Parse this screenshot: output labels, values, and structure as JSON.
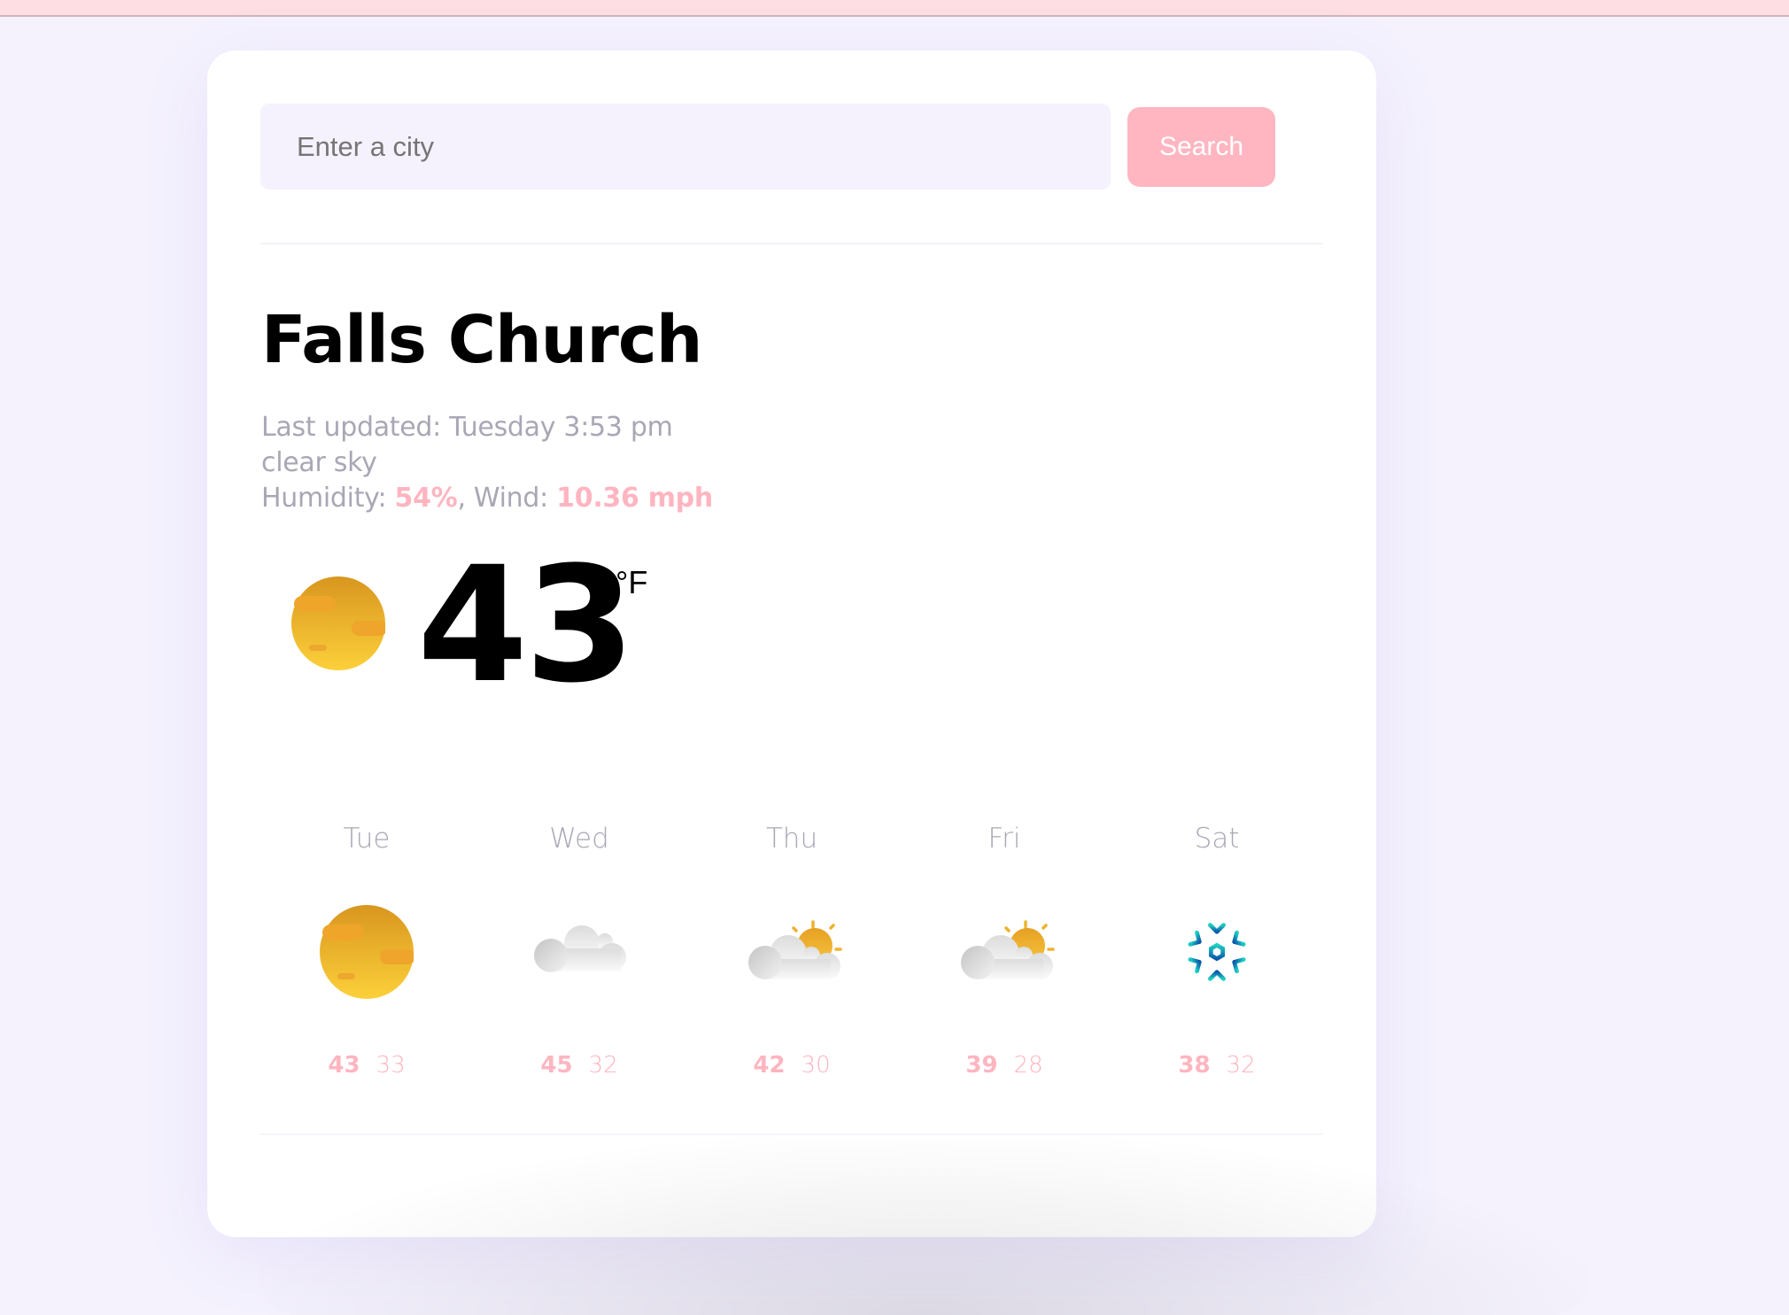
{
  "search": {
    "placeholder": "Enter a city",
    "value": "",
    "button_label": "Search"
  },
  "current": {
    "city": "Falls Church",
    "last_updated_label": "Last updated:",
    "last_updated": "Tuesday 3:53 pm",
    "description": "clear sky",
    "humidity_label": "Humidity:",
    "humidity": "54%",
    "wind_label": ", Wind:",
    "wind": "10.36 mph",
    "temperature": "43",
    "unit": "°F",
    "icon": "clear-sky-sun-icon"
  },
  "forecast": [
    {
      "day": "Tue",
      "icon": "clear-sky-sun-icon",
      "high": "43",
      "low": "33"
    },
    {
      "day": "Wed",
      "icon": "cloudy-icon",
      "high": "45",
      "low": "32"
    },
    {
      "day": "Thu",
      "icon": "partly-cloudy-icon",
      "high": "42",
      "low": "30"
    },
    {
      "day": "Fri",
      "icon": "partly-cloudy-icon",
      "high": "39",
      "low": "28"
    },
    {
      "day": "Sat",
      "icon": "snow-icon",
      "high": "38",
      "low": "32"
    }
  ],
  "colors": {
    "accent_pink": "#FFB5C0",
    "button_pink": "#FFB6C1",
    "muted_text": "#A9A7B5",
    "background": "#F5F2FE",
    "topbar": "#FFDEE3"
  }
}
